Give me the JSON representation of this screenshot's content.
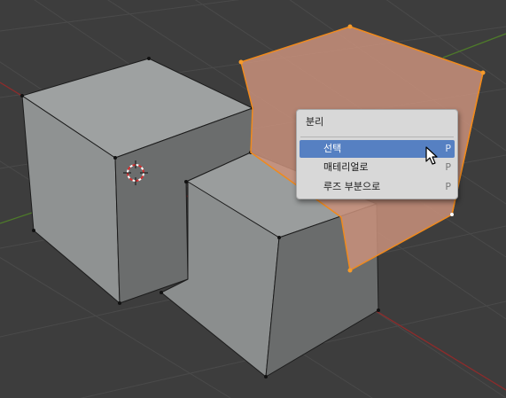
{
  "context_menu": {
    "title": "분리",
    "items": [
      {
        "label": "선택",
        "shortcut": "P",
        "active": true
      },
      {
        "label": "매테리얼로",
        "shortcut": "P",
        "active": false
      },
      {
        "label": "루즈 부분으로",
        "shortcut": "P",
        "active": false
      }
    ]
  },
  "colors": {
    "viewport_bg": "#3d3d3d",
    "selection_orange": "#f08a1c",
    "menu_highlight": "#5680c2",
    "x_axis": "#8e2b2b",
    "y_axis": "#4e7a2a"
  }
}
